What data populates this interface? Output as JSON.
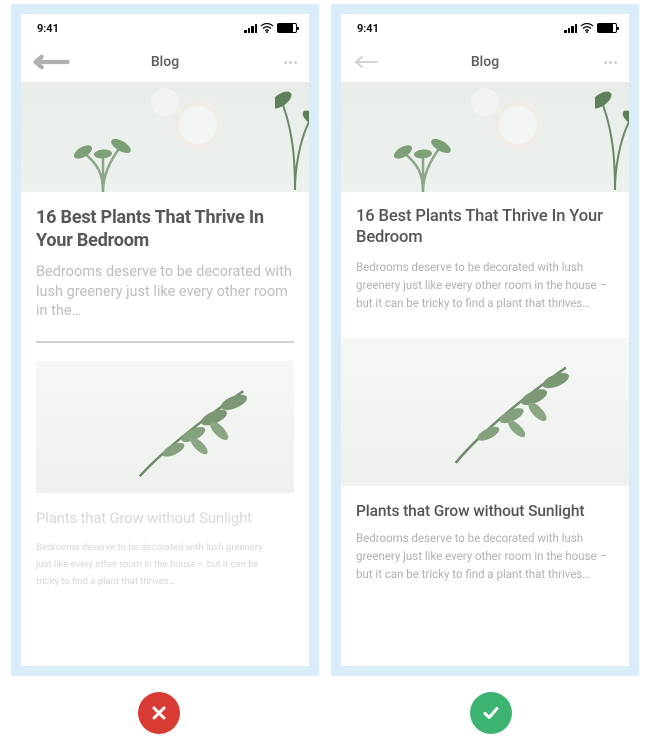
{
  "status": {
    "time": "9:41"
  },
  "nav": {
    "title": "Blog"
  },
  "articles": [
    {
      "title": "16 Best Plants That Thrive In Your Bedroom",
      "excerpt_bad": "Bedrooms deserve to be decorated with lush greenery just like every other room in the…",
      "excerpt_good": "Bedrooms deserve to be decorated with lush greenery just like every other room in the house – but it can be tricky to find a plant that thrives…"
    },
    {
      "title": "Plants that Grow without Sunlight",
      "excerpt_bad": "Bedrooms deserve to be decorated with lush greenery just like every other room in the house – but it can be tricky to find a plant that thrives…",
      "excerpt_good": "Bedrooms deserve to be decorated with lush greenery just like every other room in the house – but it can be tricky to find a plant that thrives…"
    }
  ],
  "comparison": {
    "left": "incorrect",
    "right": "correct"
  }
}
